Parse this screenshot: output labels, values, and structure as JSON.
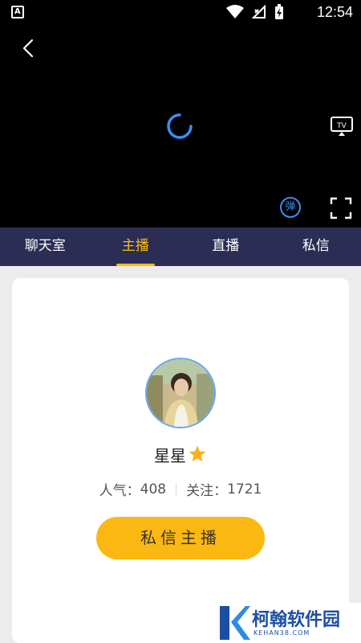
{
  "status_bar": {
    "time": "12:54",
    "icons": [
      "a11y-icon",
      "wifi-icon",
      "no-signal-icon",
      "battery-icon"
    ]
  },
  "player": {
    "danmu_label": "弹",
    "icons": [
      "back-icon",
      "loading-spinner-icon",
      "tv-cast-icon",
      "fullscreen-icon"
    ],
    "accent_color": "#3b8ef0"
  },
  "tabs": [
    {
      "label": "聊天室",
      "active": false
    },
    {
      "label": "主播",
      "active": true
    },
    {
      "label": "直播",
      "active": false
    },
    {
      "label": "私信",
      "active": false
    }
  ],
  "anchor": {
    "name": "星星",
    "popularity_label": "人气：",
    "popularity_value": "408",
    "follow_label": "关注：",
    "follow_value": "1721",
    "message_button": "私信主播"
  },
  "watermark": {
    "name": "柯翰软件园",
    "url": "KEHAN38.COM"
  },
  "colors": {
    "tab_bar": "#2c2d55",
    "accent": "#fbbd12",
    "button": "#fbb812"
  }
}
